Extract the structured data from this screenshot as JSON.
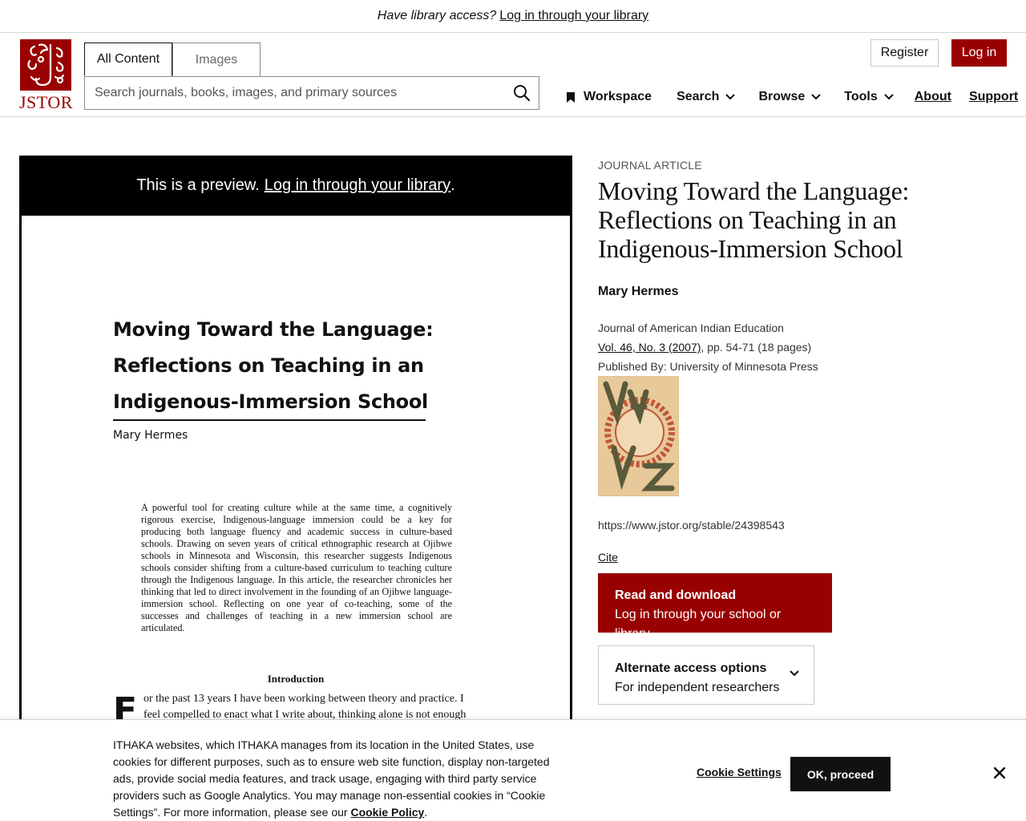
{
  "banner": {
    "prompt": "Have library access?",
    "link": "Log in through your library"
  },
  "header": {
    "logo_text": "JSTOR",
    "tabs": [
      {
        "label": "All Content",
        "active": true
      },
      {
        "label": "Images",
        "active": false
      }
    ],
    "search": {
      "placeholder": "Search journals, books, images, and primary sources",
      "value": ""
    },
    "register_label": "Register",
    "login_label": "Log in",
    "nav": [
      {
        "label": "Workspace",
        "icon": "bookmark-icon"
      },
      {
        "label": "Search",
        "icon": "chevron-down-icon"
      },
      {
        "label": "Browse",
        "icon": "chevron-down-icon"
      },
      {
        "label": "Tools",
        "icon": "chevron-down-icon"
      },
      {
        "label": "About"
      },
      {
        "label": "Support"
      }
    ]
  },
  "preview": {
    "notice": "This is a preview.",
    "notice_link": "Log in through your library",
    "notice_end": ".",
    "page": {
      "title_lines": [
        "Moving Toward the Language:",
        "Reflections on Teaching in an",
        "Indigenous-Immersion School"
      ],
      "author": "Mary Hermes",
      "abstract": "A powerful tool for creating culture while at the same time, a cognitively rigorous exercise, Indigenous-language immersion could be a key for producing both language fluency and academic success in culture-based schools. Drawing on seven years of critical ethnographic research at Ojibwe schools in Minnesota and Wisconsin, this researcher suggests Indigenous schools consider shifting from a culture-based curriculum to teaching culture through the Indigenous language. In this article, the researcher chronicles her thinking that led to direct involvement in the founding of an Ojibwe language-immersion school. Reflecting on one year of co-teaching, some of the successes and challenges of teaching in a new immersion school are articulated.",
      "section_heading": "Introduction",
      "drop_cap": "F",
      "body": "or the past 13 years I have been working between theory and practice. I feel compelled to enact what I write about, thinking alone is not enough"
    }
  },
  "article": {
    "type_label": "JOURNAL ARTICLE",
    "title": "Moving Toward the Language: Reflections on Teaching in an Indigenous-Immersion School",
    "author": "Mary Hermes",
    "journal": "Journal of American Indian Education",
    "volume_link": "Vol. 46, No. 3 (2007)",
    "pages": ", pp. 54-71 (18 pages)",
    "publisher": "Published By: University of Minnesota Press",
    "stable_url": "https://www.jstor.org/stable/24398543",
    "cite_label": "Cite",
    "read_title": "Read and download",
    "read_sub": "Log in through your school or library",
    "alt_title": "Alternate access options",
    "alt_sub": "For independent researchers"
  },
  "cookie": {
    "text": "ITHAKA websites, which ITHAKA manages from its location in the United States, use cookies for different purposes, such as to ensure web site function, display non-targeted ads, provide social media features, and track usage, engaging with third party service providers such as Google Analytics. You may manage non-essential cookies in “Cookie Settings”. For more information, please see our ",
    "policy_link": "Cookie Policy",
    "policy_end": ".",
    "settings_label": "Cookie Settings",
    "ok_label": "OK, proceed"
  },
  "colors": {
    "brand": "#990000",
    "text": "#111111",
    "border": "#c8c8c8"
  }
}
